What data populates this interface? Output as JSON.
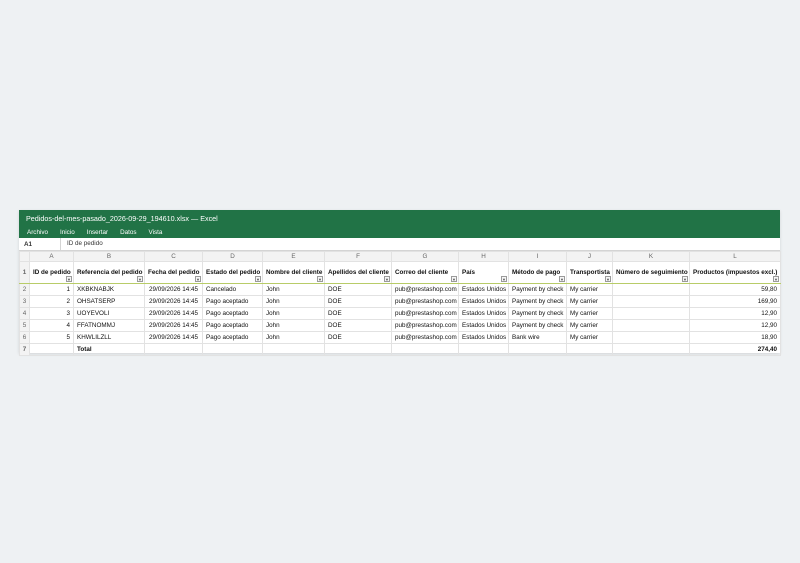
{
  "window": {
    "title": "Pedidos-del-mes-pasado_2026-09-29_194610.xlsx — Excel"
  },
  "menu": [
    "Archivo",
    "Inicio",
    "Insertar",
    "Datos",
    "Vista"
  ],
  "formula_bar": {
    "cell_ref": "A1",
    "value": "ID de pedido"
  },
  "columns": [
    "A",
    "B",
    "C",
    "D",
    "E",
    "F",
    "G",
    "H",
    "I",
    "J",
    "K",
    "L"
  ],
  "headers": [
    "ID de pedido",
    "Referencia del pedido",
    "Fecha del pedido",
    "Estado del pedido",
    "Nombre del cliente",
    "Apellidos del cliente",
    "Correo del cliente",
    "País",
    "Método de pago",
    "Transportista",
    "Número de seguimiento",
    "Productos (impuestos excl.)"
  ],
  "rows": [
    [
      "1",
      "XKBKNABJK",
      "29/09/2026 14:45",
      "Cancelado",
      "John",
      "DOE",
      "pub@prestashop.com",
      "Estados Unidos",
      "Payment by check",
      "My carrier",
      "",
      "59,80"
    ],
    [
      "2",
      "OHSATSERP",
      "29/09/2026 14:45",
      "Pago aceptado",
      "John",
      "DOE",
      "pub@prestashop.com",
      "Estados Unidos",
      "Payment by check",
      "My carrier",
      "",
      "169,90"
    ],
    [
      "3",
      "UOYEVOLI",
      "29/09/2026 14:45",
      "Pago aceptado",
      "John",
      "DOE",
      "pub@prestashop.com",
      "Estados Unidos",
      "Payment by check",
      "My carrier",
      "",
      "12,90"
    ],
    [
      "4",
      "FFATNOMMJ",
      "29/09/2026 14:45",
      "Pago aceptado",
      "John",
      "DOE",
      "pub@prestashop.com",
      "Estados Unidos",
      "Payment by check",
      "My carrier",
      "",
      "12,90"
    ],
    [
      "5",
      "KHWLILZLL",
      "29/09/2026 14:45",
      "Pago aceptado",
      "John",
      "DOE",
      "pub@prestashop.com",
      "Estados Unidos",
      "Bank wire",
      "My carrier",
      "",
      "18,90"
    ]
  ],
  "total_row": {
    "label": "Total",
    "amount": "274,40"
  },
  "row_numbers": [
    "1",
    "2",
    "3",
    "4",
    "5",
    "6",
    "7"
  ],
  "filter_icon": "dropdown-arrow-icon",
  "colors": {
    "title_bar": "#217346",
    "header_underline": "#b8cc68"
  }
}
